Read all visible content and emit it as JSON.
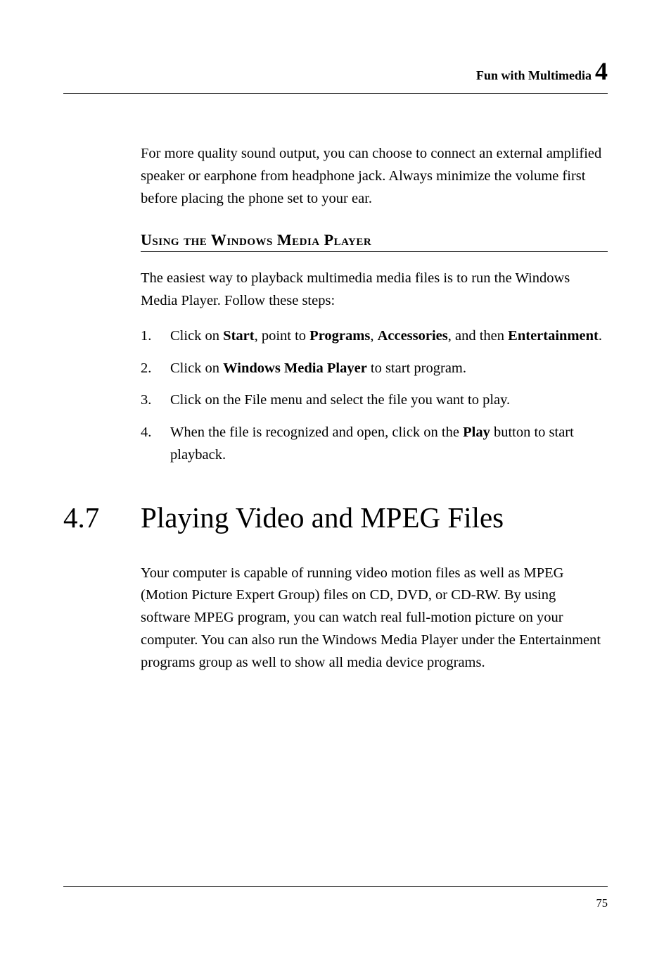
{
  "header": {
    "text": "Fun with Multimedia",
    "chapter": "4"
  },
  "paragraphs": {
    "p1": "For more quality sound output, you can choose to connect an external amplified speaker or earphone from headphone jack. Always minimize the volume first before placing the phone set to your ear.",
    "section_heading_prefix": "U",
    "section_heading_rest": "sing the Windows Media Player",
    "p2": "The easiest way to playback multimedia media files is to run the Windows Media Player. Follow these steps:",
    "p3": "Your computer is capable of running video motion files as well as MPEG (Motion Picture Expert Group) files on CD, DVD, or CD-RW. By using software MPEG program, you can watch real full-motion picture on your computer. You can also run the Windows Media Player under the Entertainment programs group as well to show all media device programs."
  },
  "steps": {
    "s1_num": "1.",
    "s1_a": "Click on ",
    "s1_b1": "Start",
    "s1_c": ", point to ",
    "s1_b2": "Programs",
    "s1_d": ", ",
    "s1_b3": "Accessories",
    "s1_e": ", and then ",
    "s1_b4": "Entertainment",
    "s1_f": ".",
    "s2_num": "2.",
    "s2_a": "Click on ",
    "s2_b1": "Windows Media Player",
    "s2_c": " to start program.",
    "s3_num": "3.",
    "s3_a": "Click on the File menu and select the file you want to play.",
    "s4_num": "4.",
    "s4_a": "When the file is recognized and open, click on the ",
    "s4_b1": "Play",
    "s4_c": " button to start playback."
  },
  "section": {
    "number": "4.7",
    "title": "Playing Video and MPEG Files"
  },
  "page_number": "75"
}
